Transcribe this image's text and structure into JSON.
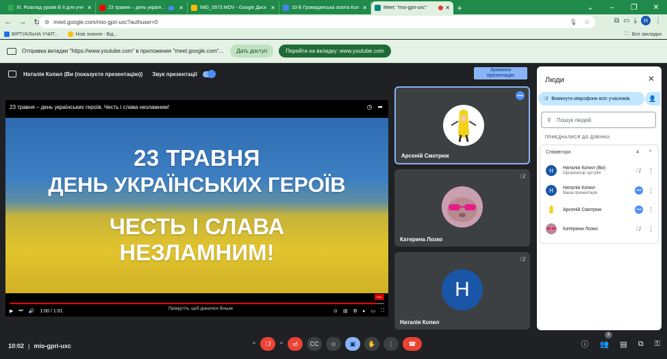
{
  "browser": {
    "tabs": [
      {
        "label": "XI. Розклад уроків Б ІІ для учн",
        "color": "#34a853"
      },
      {
        "label": "23 травня – день українськ",
        "color": "#ff0000"
      },
      {
        "label": "IMG_0973.MOV - Google Диск",
        "color": "#fbbc04"
      },
      {
        "label": "10-Б Громадянська освіта Кол",
        "color": "#4285f4"
      },
      {
        "label": "Meet: \"mio-gpri-uxc\"",
        "color": "#00897b"
      }
    ],
    "url": "meet.google.com/mio-gpri-uxc?authuser=0",
    "profile_initial": "H"
  },
  "bookmarks": {
    "items": [
      {
        "label": "ВІРТУАЛЬНА УЧИТ...",
        "color": "#1a73e8"
      },
      {
        "label": "Нові знання - Від...",
        "color": "#fbbc04"
      }
    ],
    "all_label": "Все закладки"
  },
  "infobar": {
    "message": "Отправка вкладки \"https://www.youtube.com\" в приложение \"meet.google.com\"...",
    "allow_label": "Дать доступ",
    "switch_label": "Перейти на вкладку: www.youtube.com"
  },
  "presentation": {
    "presenter_label": "Наталія Копил (Ви (показуєте презентацію))",
    "sound_label": "Звук презентації",
    "stop_label_1": "Зупинити",
    "stop_label_2": "презентацію"
  },
  "video": {
    "title": "23 травня – день українських героїв. Честь і слава незламним!",
    "line1": "23 ТРАВНЯ",
    "line2": "ДЕНЬ УКРАЇНСЬКИХ ГЕРОЇВ",
    "line3": "ЧЕСТЬ І СЛАВА",
    "line4": "НЕЗЛАМНИМ!",
    "time": "1:00 / 1:01",
    "scroll_hint": "Прокрутіть, щоб дізнатися більше",
    "progress": 0.98,
    "badge": "SHL"
  },
  "tiles": [
    {
      "name": "Арсеній Смотрюк"
    },
    {
      "name": "Катерина Лозко"
    },
    {
      "name": "Наталія Копил",
      "initial": "H"
    }
  ],
  "meeting": {
    "time": "10:02",
    "separator": "|",
    "code": "mio-gpri-uxc",
    "participants_count": "4"
  },
  "people": {
    "title": "Люди",
    "mute_all_label": "Вимкнути мікрофони всіх учасників",
    "search_placeholder": "Пошук людей",
    "section_label": "ПРИЄДНАЛИСЯ ДО ДЗВІНКА",
    "group_label": "Співавтори",
    "group_count": "4",
    "list": [
      {
        "name": "Наталія Копил (Ви)",
        "role": "Організатор зустрічі",
        "initial": "H"
      },
      {
        "name": "Наталія Копил",
        "role": "Ваша презентація",
        "initial": "H"
      },
      {
        "name": "Арсеній Смотрюк",
        "role": ""
      },
      {
        "name": "Катерина Лозко",
        "role": ""
      }
    ]
  }
}
